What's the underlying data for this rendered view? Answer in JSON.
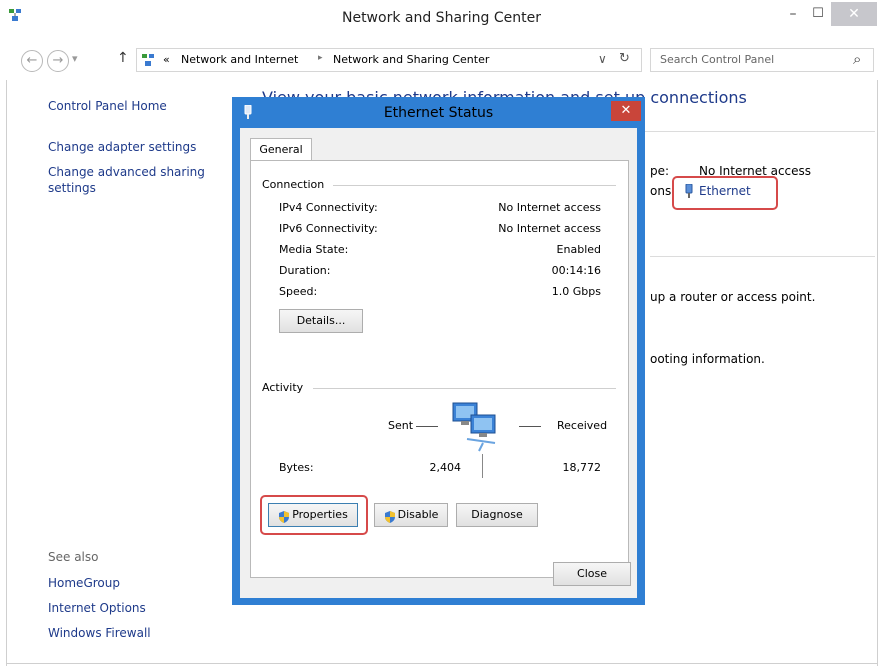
{
  "window": {
    "title": "Network and Sharing Center",
    "minimize": "–",
    "maximize": "☐",
    "close": "✕"
  },
  "address": {
    "back": "←",
    "forward": "→",
    "dropdown": "▾",
    "up": "↑",
    "sep1": "«",
    "crumb1": "Network and Internet",
    "sep2": "▸",
    "crumb2": "Network and Sharing Center",
    "addr_dropdown": "∨",
    "refresh": "↻",
    "search_placeholder": "Search Control Panel",
    "search_icon": "⌕"
  },
  "sidebar": {
    "home": "Control Panel Home",
    "change_adapter": "Change adapter settings",
    "change_sharing_1": "Change advanced sharing",
    "change_sharing_2": "settings",
    "see_also": "See also",
    "homegroup": "HomeGroup",
    "internet_options": "Internet Options",
    "firewall": "Windows Firewall"
  },
  "main": {
    "heading": "View your basic network information and set up connections",
    "access_type_label": "pe:",
    "access_type_value": "No Internet access",
    "connections_label": "ons:",
    "connections_value": "Ethernet",
    "router_text": "up a router or access point.",
    "troubleshoot_text": "ooting information."
  },
  "dialog": {
    "title": "Ethernet Status",
    "close": "✕",
    "tab": "General",
    "connection_group": "Connection",
    "rows": [
      {
        "label": "IPv4 Connectivity:",
        "value": "No Internet access"
      },
      {
        "label": "IPv6 Connectivity:",
        "value": "No Internet access"
      },
      {
        "label": "Media State:",
        "value": "Enabled"
      },
      {
        "label": "Duration:",
        "value": "00:14:16"
      },
      {
        "label": "Speed:",
        "value": "1.0 Gbps"
      }
    ],
    "details_button": "Details...",
    "activity_group": "Activity",
    "sent_label": "Sent",
    "received_label": "Received",
    "bytes_label": "Bytes:",
    "bytes_sent": "2,404",
    "bytes_received": "18,772",
    "properties_button": "Properties",
    "disable_button": "Disable",
    "diagnose_button": "Diagnose",
    "close_button": "Close"
  },
  "colors": {
    "dialog_frame": "#2f7fd3",
    "link": "#1e3a8a",
    "highlight": "#d64a4a"
  }
}
